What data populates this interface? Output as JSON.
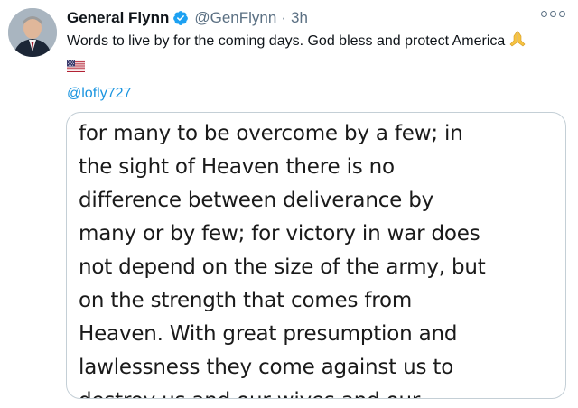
{
  "tweet": {
    "display_name": "General Flynn",
    "verified_icon": "verified-badge-icon",
    "handle": "@GenFlynn",
    "separator": "·",
    "timestamp": "3h",
    "text": "Words to live by for the coming days. God bless and protect America",
    "emoji_pray": "praying-hands-icon",
    "emoji_flag": "us-flag-icon",
    "mention": "@lofly727",
    "colors": {
      "link": "#1b95e0",
      "verified": "#1da1f2",
      "muted": "#5b7083",
      "border": "#c4cfd6"
    }
  },
  "media": {
    "lines": [
      "for many to be overcome by a few; in",
      "the sight of Heaven there is no",
      "difference between deliverance by",
      "many or by few; for victory in war does",
      "not depend on the size of the army, but",
      "on the strength that comes from",
      "Heaven. With great presumption and",
      "lawlessness they come against us to",
      "destroy us and our wives and our"
    ]
  }
}
